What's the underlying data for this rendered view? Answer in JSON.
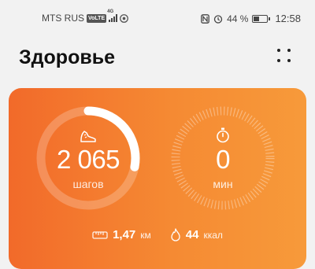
{
  "status": {
    "carrier": "MTS RUS",
    "volte": "VoLTE",
    "network": "4G",
    "battery_percent": "44 %",
    "battery_level": 0.44,
    "time": "12:58"
  },
  "header": {
    "title": "Здоровье"
  },
  "activity": {
    "steps_value": "2 065",
    "steps_unit": "шагов",
    "steps_goal_fraction": 0.28,
    "minutes_value": "0",
    "minutes_unit": "мин",
    "distance_value": "1,47",
    "distance_unit": "км",
    "calories_value": "44",
    "calories_unit": "ккал"
  },
  "icons": {
    "shoe": "shoe-icon",
    "stopwatch": "stopwatch-icon",
    "ruler": "ruler-icon",
    "flame": "flame-icon",
    "menu": "more-icon"
  }
}
